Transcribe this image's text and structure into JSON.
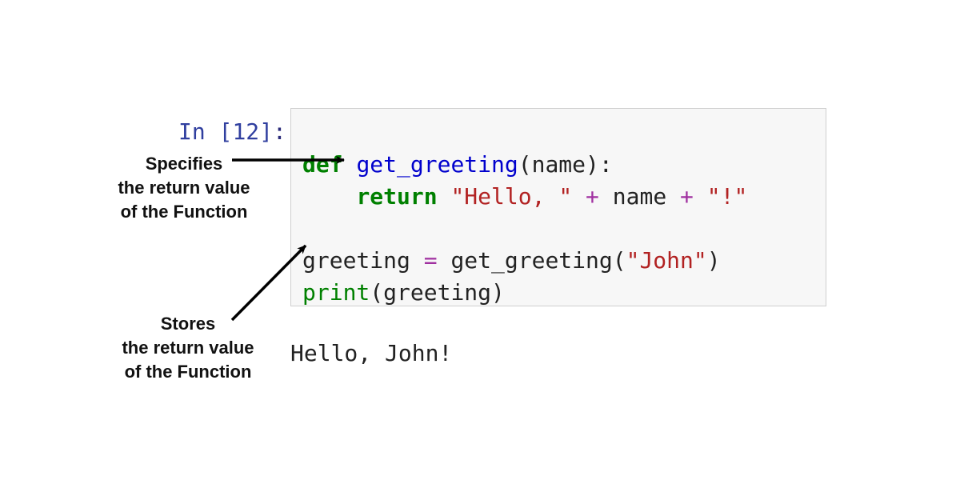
{
  "prompt": {
    "label_in": "In ",
    "open": "[",
    "number": "12",
    "close": "]",
    "colon": ": "
  },
  "code": {
    "line1": {
      "def": "def",
      "sp1": " ",
      "func": "get_greeting",
      "lpar": "(",
      "arg": "name",
      "rpar": ")",
      "colon": ":"
    },
    "line2": {
      "indent": "    ",
      "ret": "return",
      "sp1": " ",
      "str1": "\"Hello, \"",
      "sp2": " ",
      "plus1": "+",
      "sp3": " ",
      "name": "name",
      "sp4": " ",
      "plus2": "+",
      "sp5": " ",
      "str2": "\"!\""
    },
    "line3": "",
    "line4": {
      "var": "greeting",
      "sp1": " ",
      "eq": "=",
      "sp2": " ",
      "call": "get_greeting",
      "lpar": "(",
      "arg": "\"John\"",
      "rpar": ")"
    },
    "line5": {
      "print": "print",
      "lpar": "(",
      "arg": "greeting",
      "rpar": ")"
    }
  },
  "output": {
    "text": "Hello, John!"
  },
  "annotations": {
    "specifies": {
      "l1": "Specifies",
      "l2": "the return value",
      "l3": "of the Function"
    },
    "stores": {
      "l1": "Stores",
      "l2": "the return value",
      "l3": "of the Function"
    }
  }
}
